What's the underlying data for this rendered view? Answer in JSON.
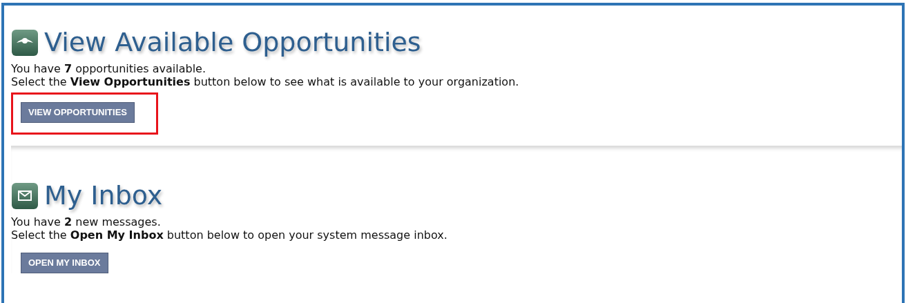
{
  "sections": [
    {
      "kind": "eye",
      "title": "View Available Opportunities",
      "lines": [
        "You have **7** opportunities available.",
        "Select the **View Opportunities** button below to see what is available to your organization."
      ],
      "button": "VIEW OPPORTUNITIES",
      "highlighted": true
    },
    {
      "kind": "envelope",
      "title": "My Inbox",
      "lines": [
        "You have **2** new messages.",
        "Select the **Open My Inbox** button below to open your system message inbox."
      ],
      "button": "OPEN MY INBOX",
      "highlighted": false
    }
  ]
}
